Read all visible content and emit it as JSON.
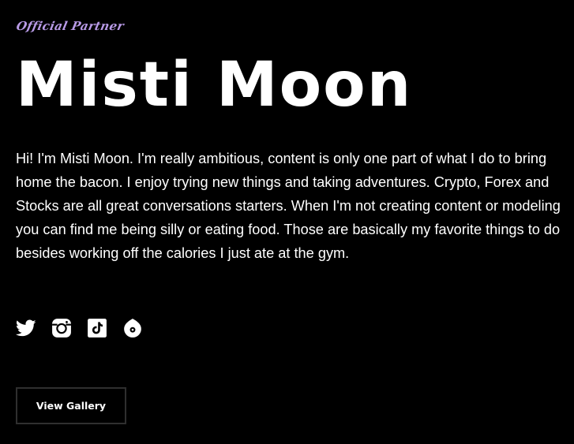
{
  "header": {
    "kicker": "Official Partner",
    "name": "Misti Moon"
  },
  "bio": "Hi! I'm Misti Moon. I'm really ambitious, content is only one part of what I do to bring home the bacon. I enjoy trying new things and taking adventures. Crypto, Forex and Stocks are all great conversations starters. When I'm not creating content or modeling you can find me being silly or eating food. Those are basically my favorite things to do besides working off the calories I just ate at the gym.",
  "social_links": [
    {
      "icon": "twitter-icon"
    },
    {
      "icon": "instagram-icon"
    },
    {
      "icon": "tiktok-icon"
    },
    {
      "icon": "onlyfans-icon"
    }
  ],
  "cta": {
    "label": "View Gallery"
  },
  "colors": {
    "background": "#000000",
    "text": "#ffffff",
    "accent": "#b89ae6",
    "button_border": "#2f2f2f"
  }
}
